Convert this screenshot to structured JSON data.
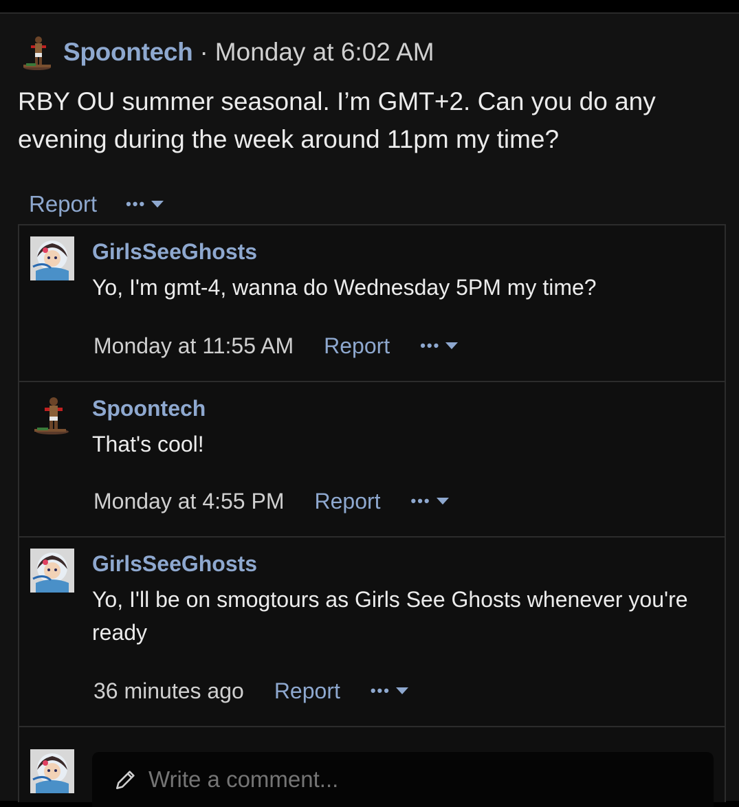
{
  "post": {
    "author": "Spoontech",
    "separator": "·",
    "time": "Monday at 6:02 AM",
    "body": "RBY OU summer seasonal. I’m GMT+2. Can you do any evening during the week around 11pm my time?",
    "report_label": "Report",
    "more_label": "•••",
    "avatar_icon": "boxer-sprite-icon"
  },
  "comments": [
    {
      "author": "GirlsSeeGhosts",
      "text": "Yo, I'm gmt-4, wanna do Wednesday 5PM my time?",
      "time": "Monday at 11:55 AM",
      "report_label": "Report",
      "more_label": "•••",
      "avatar_icon": "anime-girl-avatar-icon"
    },
    {
      "author": "Spoontech",
      "text": "That's cool!",
      "time": "Monday at 4:55 PM",
      "report_label": "Report",
      "more_label": "•••",
      "avatar_icon": "boxer-sprite-icon"
    },
    {
      "author": "GirlsSeeGhosts",
      "text": "Yo, I'll be on smogtours as Girls See Ghosts whenever you're ready",
      "time": "36 minutes ago",
      "report_label": "Report",
      "more_label": "•••",
      "avatar_icon": "anime-girl-avatar-icon"
    }
  ],
  "reply": {
    "placeholder": "Write a comment...",
    "avatar_icon": "anime-girl-avatar-icon",
    "pencil_icon": "pencil-icon"
  },
  "colors": {
    "background": "#121212",
    "link": "#8ea8cf",
    "text": "#ececec",
    "border": "#2c2c2c"
  }
}
